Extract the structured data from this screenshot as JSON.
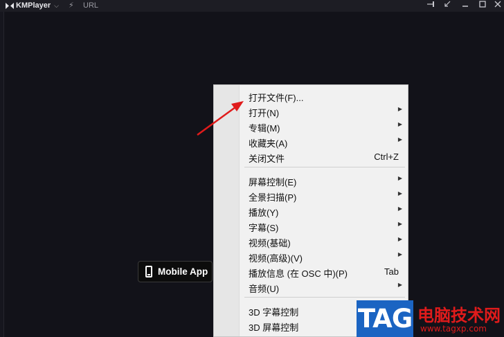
{
  "titlebar": {
    "app_name": "KMPlayer",
    "caret": "⌵",
    "url_label": "URL",
    "controls": [
      "pin-icon",
      "restore-small-icon",
      "minimize-icon",
      "maximize-icon",
      "close-icon"
    ]
  },
  "mobile_app": {
    "label": "Mobile App"
  },
  "menu": {
    "items": [
      {
        "label": "打开文件(F)...",
        "shortcut": "",
        "submenu": false
      },
      {
        "label": "打开(N)",
        "shortcut": "",
        "submenu": true
      },
      {
        "label": "专辑(M)",
        "shortcut": "",
        "submenu": true
      },
      {
        "label": "收藏夹(A)",
        "shortcut": "",
        "submenu": true
      },
      {
        "label": "关闭文件",
        "shortcut": "Ctrl+Z",
        "submenu": false
      },
      {
        "label": "屏幕控制(E)",
        "shortcut": "",
        "submenu": true
      },
      {
        "label": "全景扫描(P)",
        "shortcut": "",
        "submenu": true
      },
      {
        "label": "播放(Y)",
        "shortcut": "",
        "submenu": true
      },
      {
        "label": "字幕(S)",
        "shortcut": "",
        "submenu": true
      },
      {
        "label": "视频(基础)",
        "shortcut": "",
        "submenu": true
      },
      {
        "label": "视频(高级)(V)",
        "shortcut": "",
        "submenu": true
      },
      {
        "label": "播放信息 (在 OSC 中)(P)",
        "shortcut": "Tab",
        "submenu": false
      },
      {
        "label": "音频(U)",
        "shortcut": "",
        "submenu": true
      },
      {
        "label": "3D 字幕控制",
        "shortcut": "",
        "submenu": false
      },
      {
        "label": "3D 屏幕控制",
        "shortcut": "",
        "submenu": false
      }
    ],
    "arrow_glyph": "▶"
  },
  "watermark": {
    "tag": "TAG",
    "site_cn": "电脑技术网",
    "site_url": "www.tagxp.com"
  },
  "colors": {
    "accent_red": "#e01b1b",
    "tag_blue": "#1b64c2",
    "background": "#121219"
  }
}
